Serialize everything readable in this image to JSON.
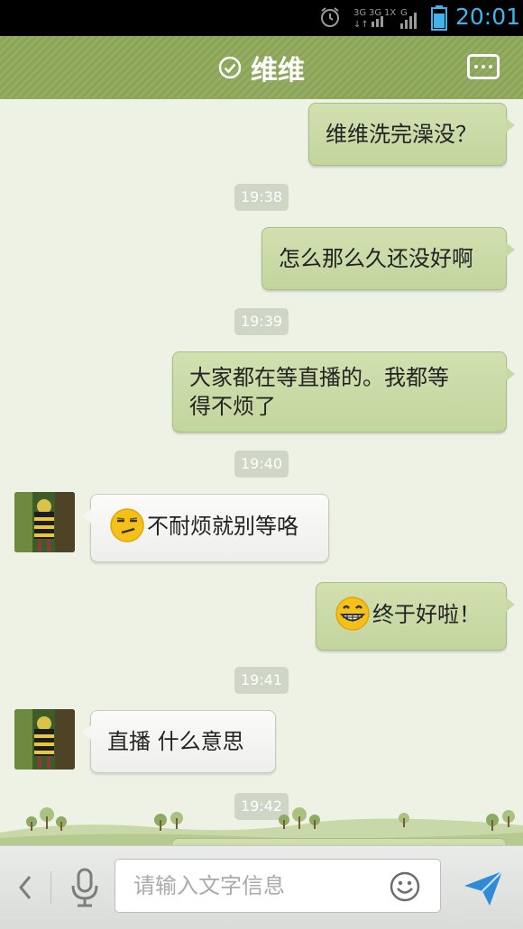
{
  "status_bar": {
    "time": "20:01",
    "icons": [
      "alarm-icon",
      "network-3g-icon",
      "signal-icon",
      "battery-icon"
    ],
    "accent_color": "#3fb4ea"
  },
  "header": {
    "title": "维维",
    "online_icon": "check-circle-icon",
    "menu_icon": "more-dots-icon",
    "background_color": "#8ea95a"
  },
  "messages": [
    {
      "side": "right",
      "text": "维维洗完澡没？"
    },
    {
      "timestamp": "19:38"
    },
    {
      "side": "right",
      "text": "怎么那么久还没好啊"
    },
    {
      "timestamp": "19:39"
    },
    {
      "side": "right",
      "text": "大家都在等直播的。我都等得不烦了"
    },
    {
      "timestamp": "19:40"
    },
    {
      "side": "left",
      "emoji": "smirk-emoji",
      "text": "不耐烦就别等咯"
    },
    {
      "side": "right",
      "emoji": "grin-emoji",
      "text": "终于好啦！"
    },
    {
      "timestamp": "19:41"
    },
    {
      "side": "left",
      "text": "直播  什么意思"
    },
    {
      "timestamp": "19:42"
    }
  ],
  "msg": {
    "m1": "维维洗完澡没？",
    "t1": "19:38",
    "m2": "怎么那么久还没好啊",
    "t2": "19:39",
    "m3_line1": "大家都在等直播的。我都等",
    "m3_line2": "得不烦了",
    "t3": "19:40",
    "m4": "不耐烦就别等咯",
    "m5": "终于好啦！",
    "t4": "19:41",
    "m6": "直播  什么意思",
    "t5": "19:42"
  },
  "input_bar": {
    "placeholder": "请输入文字信息",
    "icons": [
      "back-arrow-icon",
      "microphone-icon",
      "smiley-icon",
      "send-icon"
    ]
  }
}
